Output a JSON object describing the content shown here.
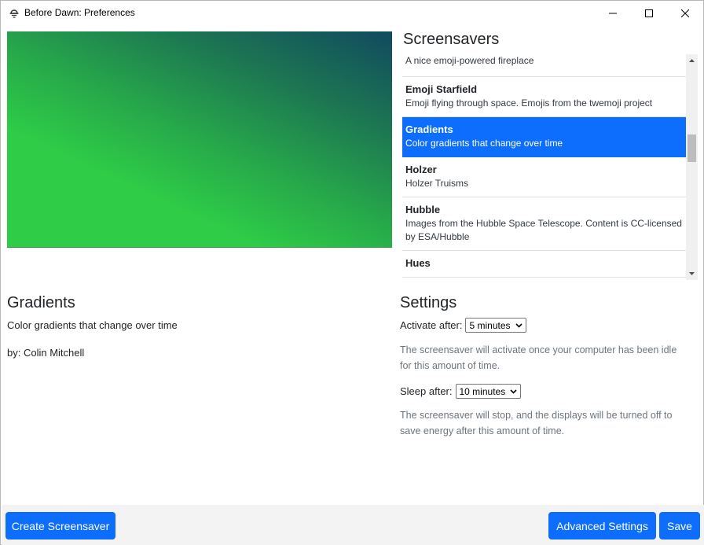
{
  "window": {
    "title": "Before Dawn: Preferences"
  },
  "screensavers": {
    "heading": "Screensavers",
    "items": [
      {
        "name": "",
        "description": "A nice emoji-powered fireplace"
      },
      {
        "name": "Emoji Starfield",
        "description": "Emoji flying through space. Emojis from the twemoji project"
      },
      {
        "name": "Gradients",
        "description": "Color gradients that change over time",
        "selected": true
      },
      {
        "name": "Holzer",
        "description": "Holzer Truisms"
      },
      {
        "name": "Hubble",
        "description": "Images from the Hubble Space Telescope. Content is CC-licensed by ESA/Hubble"
      },
      {
        "name": "Hues",
        "description": ""
      }
    ]
  },
  "detail": {
    "title": "Gradients",
    "description": "Color gradients that change over time",
    "author": "by: Colin Mitchell"
  },
  "settings": {
    "title": "Settings",
    "activate_label": "Activate after:",
    "activate_value": "5 minutes",
    "activate_help": "The screensaver will activate once your computer has been idle for this amount of time.",
    "sleep_label": "Sleep after:",
    "sleep_value": "10 minutes",
    "sleep_help": "The screensaver will stop, and the displays will be turned off to save energy after this amount of time."
  },
  "footer": {
    "create_label": "Create Screensaver",
    "advanced_label": "Advanced Settings",
    "save_label": "Save"
  },
  "colors": {
    "accent": "#0d6efd",
    "preview_dark": "#114a60",
    "preview_green": "#2ecc47"
  }
}
